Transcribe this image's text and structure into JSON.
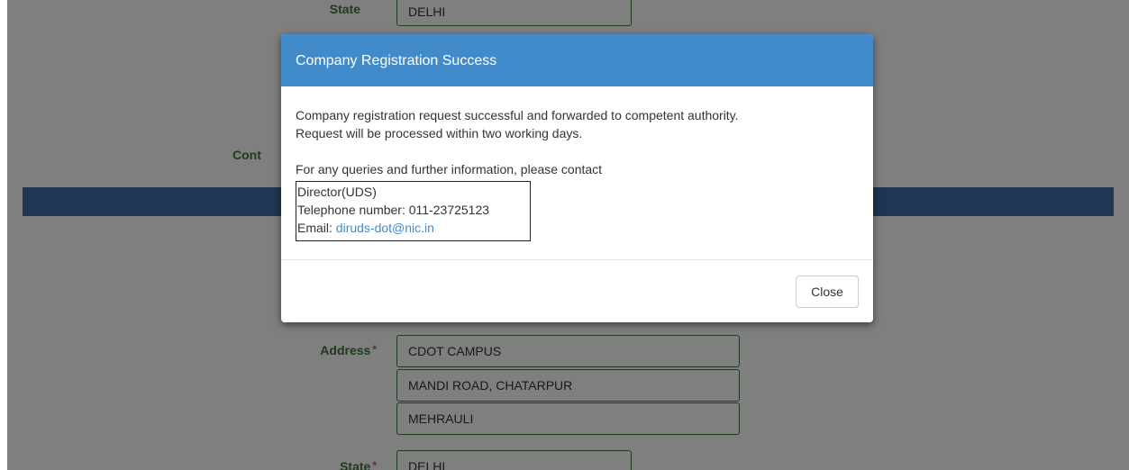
{
  "background_form": {
    "top_state_label": "State",
    "top_state_value": "DELHI",
    "partial_label": "Cont",
    "address_label": "Address",
    "address_lines": [
      "CDOT CAMPUS",
      "MANDI ROAD, CHATARPUR",
      "MEHRAULI"
    ],
    "state_label": "State",
    "state_value": "DELHI",
    "required_mark": "*"
  },
  "modal": {
    "title": "Company Registration Success",
    "line1": "Company registration request successful and forwarded to competent authority.",
    "line2": "Request will be processed within two working days.",
    "line3": "For any queries and further information, please contact",
    "contact": {
      "name": "Director(UDS)",
      "telephone_label": "Telephone number: ",
      "telephone": "011-23725123",
      "email_label": "Email: ",
      "email": "diruds-dot@nic.in"
    },
    "close_label": "Close"
  },
  "colors": {
    "header_blue": "#428bca",
    "label_green": "#3c763d",
    "band_blue": "#3f6fa5",
    "link_blue": "#428bca"
  }
}
